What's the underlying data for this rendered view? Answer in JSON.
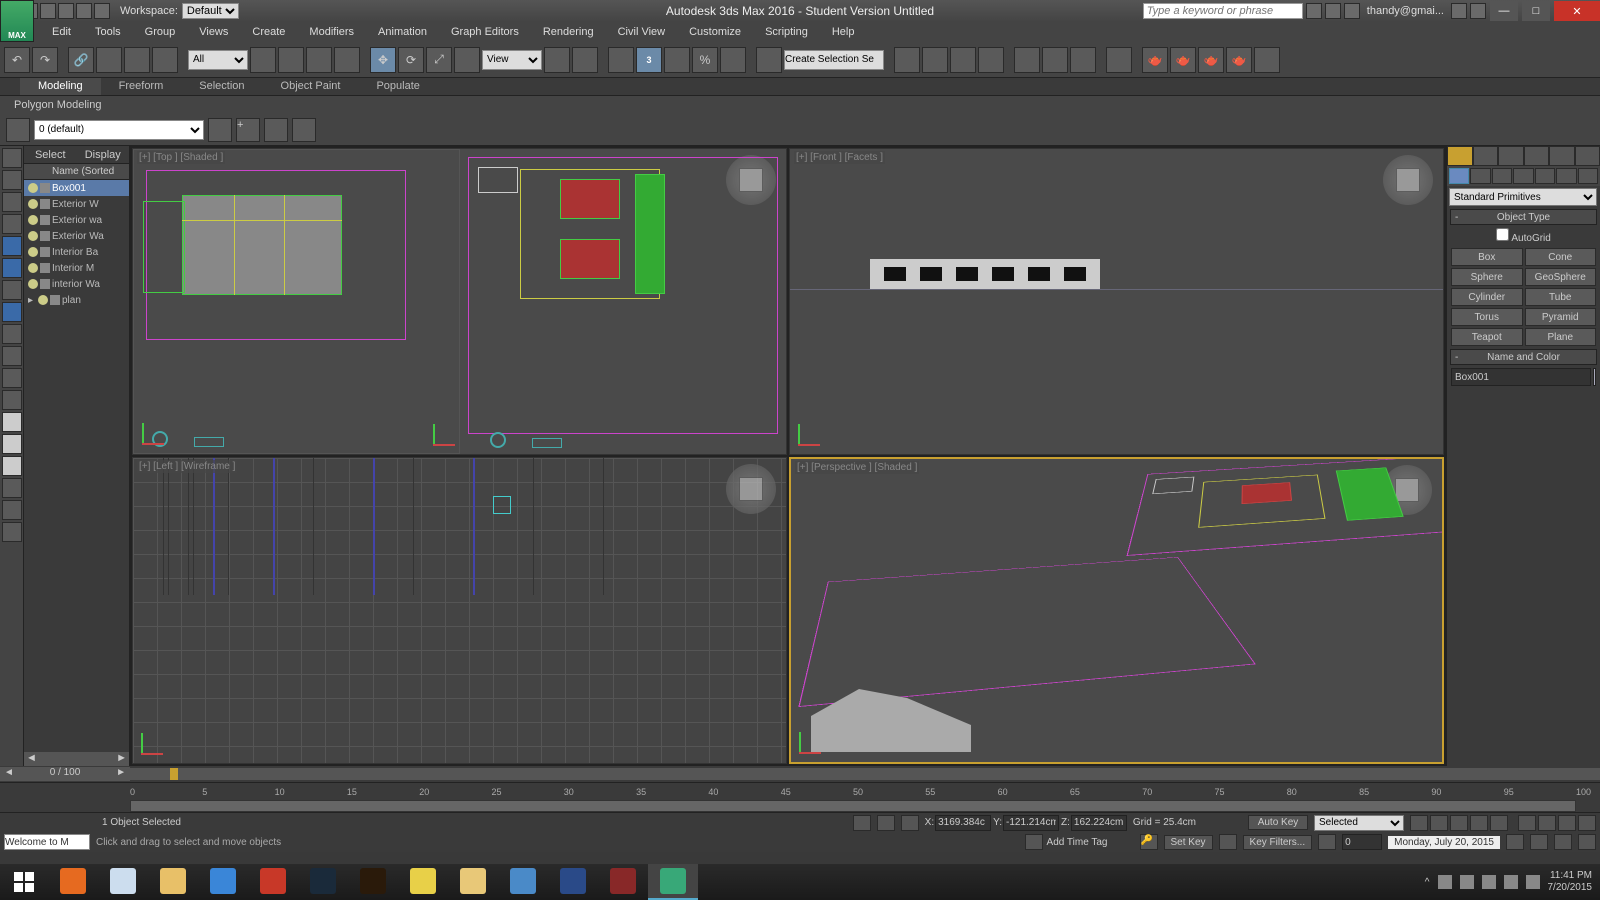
{
  "titlebar": {
    "workspace_label": "Workspace:",
    "workspace_value": "Default",
    "title": "Autodesk 3ds Max 2016 - Student Version     Untitled",
    "search_placeholder": "Type a keyword or phrase",
    "user": "thandy@gmai..."
  },
  "menubar": {
    "logo": "MAX",
    "items": [
      "Edit",
      "Tools",
      "Group",
      "Views",
      "Create",
      "Modifiers",
      "Animation",
      "Graph Editors",
      "Rendering",
      "Civil View",
      "Customize",
      "Scripting",
      "Help"
    ]
  },
  "maintoolbar": {
    "filter_all": "All",
    "named_sel": "Create Selection Se"
  },
  "ribbon": {
    "tabs": [
      "Modeling",
      "Freeform",
      "Selection",
      "Object Paint",
      "Populate"
    ],
    "sub": "Polygon Modeling"
  },
  "sectoolbar": {
    "layer": "0 (default)"
  },
  "scenex": {
    "tab_select": "Select",
    "tab_display": "Display",
    "col": "Name (Sorted Ascend",
    "items": [
      {
        "name": "Box001",
        "sel": true
      },
      {
        "name": "Exterior W",
        "sel": false
      },
      {
        "name": "Exterior wa",
        "sel": false
      },
      {
        "name": "Exterior Wa",
        "sel": false
      },
      {
        "name": "Interior Ba",
        "sel": false
      },
      {
        "name": "Interior M",
        "sel": false
      },
      {
        "name": "interior Wa",
        "sel": false
      },
      {
        "name": "plan",
        "sel": false
      }
    ]
  },
  "viewports": {
    "top": "[+] [Top ] [Shaded ]",
    "front": "[+] [Front ] [Facets ]",
    "left": "[+] [Left ] [Wireframe ]",
    "persp": "[+] [Perspective ] [Shaded ]"
  },
  "cmdpanel": {
    "dropdown": "Standard Primitives",
    "objtype_hdr": "Object Type",
    "autogrid": "AutoGrid",
    "buttons": [
      "Box",
      "Cone",
      "Sphere",
      "GeoSphere",
      "Cylinder",
      "Tube",
      "Torus",
      "Pyramid",
      "Teapot",
      "Plane"
    ],
    "namecolor_hdr": "Name and Color",
    "name_value": "Box001"
  },
  "timeline": {
    "frame": "0 / 100",
    "ticks": [
      "0",
      "5",
      "10",
      "15",
      "20",
      "25",
      "30",
      "35",
      "40",
      "45",
      "50",
      "55",
      "60",
      "65",
      "70",
      "75",
      "80",
      "85",
      "90",
      "95",
      "100"
    ]
  },
  "status": {
    "selected": "1 Object Selected",
    "x_label": "X:",
    "x": "3169.384c",
    "y_label": "Y:",
    "y": "-121.214cm",
    "z_label": "Z:",
    "z": "162.224cm",
    "grid": "Grid = 25.4cm",
    "autokey": "Auto Key",
    "setkey": "Set Key",
    "selmode": "Selected",
    "keyfilters": "Key Filters...",
    "framefield": "0",
    "script": "Welcome to M",
    "prompt": "Click and drag to select and move objects",
    "addtag": "Add Time Tag",
    "date": "Monday, July 20, 2015"
  },
  "taskbar": {
    "time": "11:41 PM",
    "date": "7/20/2015",
    "apps": [
      {
        "name": "firefox",
        "c": "#e66a20"
      },
      {
        "name": "calculator",
        "c": "#cde"
      },
      {
        "name": "paint",
        "c": "#e8c068"
      },
      {
        "name": "ie",
        "c": "#3a86d8"
      },
      {
        "name": "sketchup",
        "c": "#c83828"
      },
      {
        "name": "photoshop",
        "c": "#1a2a3a"
      },
      {
        "name": "illustrator",
        "c": "#2a1a0a"
      },
      {
        "name": "chrome",
        "c": "#e8d048"
      },
      {
        "name": "explorer",
        "c": "#e8c878"
      },
      {
        "name": "program",
        "c": "#4a8ac8"
      },
      {
        "name": "revit",
        "c": "#2a4a88"
      },
      {
        "name": "autocad",
        "c": "#882828"
      },
      {
        "name": "3dsmax",
        "c": "#38a878"
      }
    ]
  }
}
